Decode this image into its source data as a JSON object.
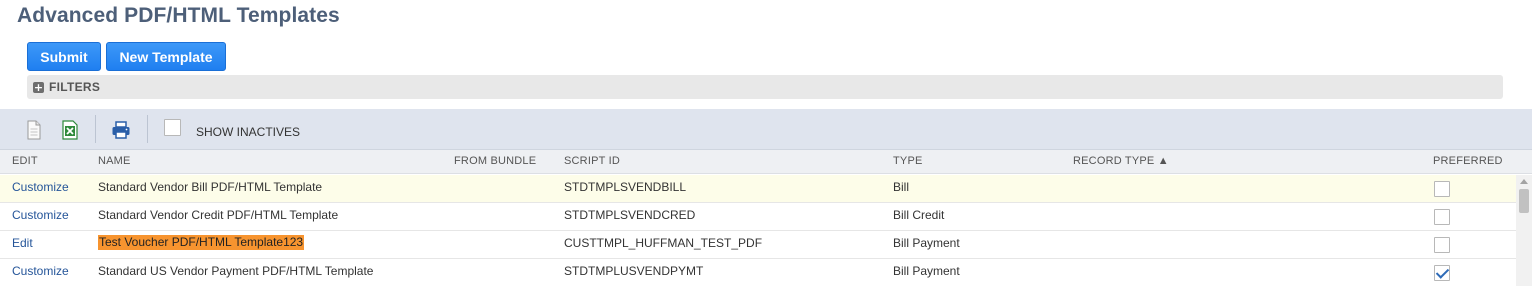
{
  "page": {
    "title": "Advanced PDF/HTML Templates"
  },
  "actions": {
    "submit_label": "Submit",
    "new_template_label": "New Template"
  },
  "filters": {
    "label": "FILTERS",
    "toggle_glyph": "+"
  },
  "toolbar": {
    "icons": [
      "new-document-icon",
      "export-excel-icon",
      "print-icon"
    ],
    "show_inactives_label": "SHOW INACTIVES",
    "show_inactives_checked": false
  },
  "table": {
    "columns": {
      "edit": "EDIT",
      "name": "NAME",
      "from_bundle": "FROM BUNDLE",
      "script_id": "SCRIPT ID",
      "type": "TYPE",
      "record_type": "RECORD TYPE ▲",
      "preferred": "PREFERRED"
    },
    "rows": [
      {
        "edit": "Customize",
        "name": "Standard Vendor Bill PDF/HTML Template",
        "from_bundle": "",
        "script_id": "STDTMPLSVENDBILL",
        "type": "Bill",
        "record_type": "",
        "preferred": false
      },
      {
        "edit": "Customize",
        "name": "Standard Vendor Credit PDF/HTML Template",
        "from_bundle": "",
        "script_id": "STDTMPLSVENDCRED",
        "type": "Bill Credit",
        "record_type": "",
        "preferred": false
      },
      {
        "edit": "Edit",
        "name": "Test Voucher PDF/HTML Template123",
        "from_bundle": "",
        "script_id": "CUSTTMPL_HUFFMAN_TEST_PDF",
        "type": "Bill Payment",
        "record_type": "",
        "preferred": false,
        "highlighted": true
      },
      {
        "edit": "Customize",
        "name": "Standard US Vendor Payment PDF/HTML Template",
        "from_bundle": "",
        "script_id": "STDTMPLUSVENDPYMT",
        "type": "Bill Payment",
        "record_type": "",
        "preferred": true
      }
    ]
  },
  "colors": {
    "title": "#4d5f79",
    "button": "#2a8af5",
    "link": "#255599",
    "highlight": "#f7942f",
    "toolbar": "#dfe4ee"
  }
}
